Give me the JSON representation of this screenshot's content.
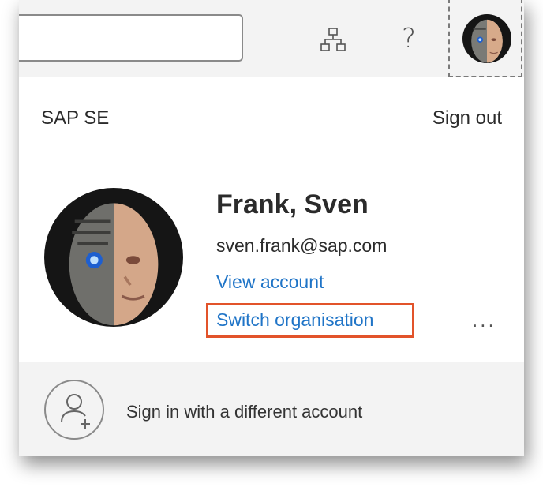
{
  "header": {
    "search_value": "",
    "org_chart_icon": "org-chart-icon",
    "help_label": "?",
    "avatar_icon": "user-avatar"
  },
  "account": {
    "organisation": "SAP SE",
    "sign_out": "Sign out",
    "name": "Frank, Sven",
    "email": "sven.frank@sap.com",
    "view_account": "View account",
    "switch_organisation": "Switch organisation",
    "more": "..."
  },
  "footer": {
    "different_account": "Sign in with a different account",
    "icon": "add-user-icon"
  },
  "colors": {
    "link": "#1f74c7",
    "highlight": "#e2532a",
    "header_bg": "#f3f3f3"
  }
}
